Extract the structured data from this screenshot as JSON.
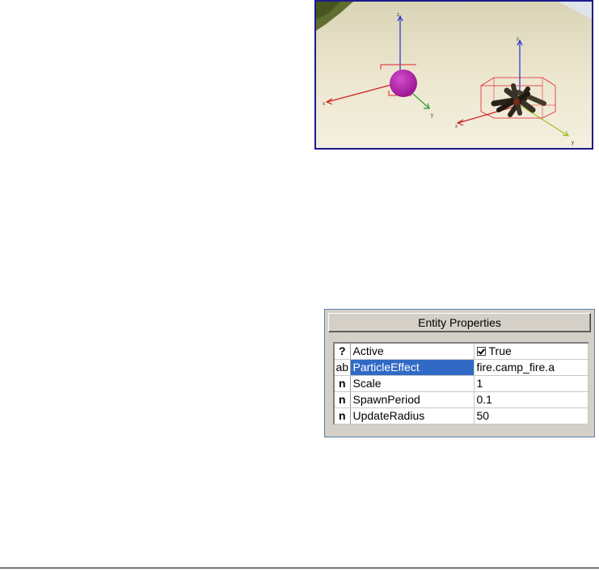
{
  "viewport": {
    "axes": {
      "sphere": {
        "x": "x",
        "y": "y",
        "z": "z"
      },
      "fire": {
        "x": "x",
        "y": "y",
        "z": "z"
      }
    },
    "colors": {
      "sphere": "#b01aa8",
      "bbox": "#e0202a",
      "x_axis": "#d02020",
      "y_axis": "#2a9a2a",
      "z_axis": "#2030d0"
    }
  },
  "panel": {
    "title": "Entity Properties",
    "rows": [
      {
        "type_icon": "?",
        "name": "Active",
        "value": "True",
        "checkbox": true,
        "selected": false
      },
      {
        "type_icon": "ab",
        "name": "ParticleEffect",
        "value": "fire.camp_fire.a",
        "checkbox": false,
        "selected": true
      },
      {
        "type_icon": "n",
        "name": "Scale",
        "value": "1",
        "checkbox": false,
        "selected": false
      },
      {
        "type_icon": "n",
        "name": "SpawnPeriod",
        "value": "0.1",
        "checkbox": false,
        "selected": false
      },
      {
        "type_icon": "n",
        "name": "UpdateRadius",
        "value": "50",
        "checkbox": false,
        "selected": false
      }
    ]
  }
}
